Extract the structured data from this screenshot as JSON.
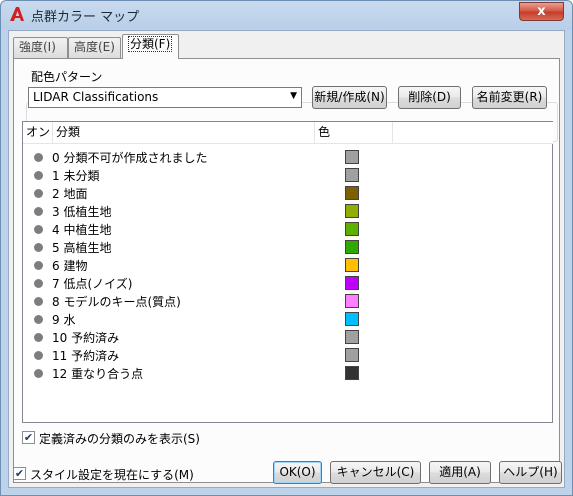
{
  "window": {
    "title": "点群カラー マップ",
    "close_glyph": "x",
    "app_icon_letter": "A"
  },
  "tabs": [
    {
      "label": "強度(I)"
    },
    {
      "label": "高度(E)"
    },
    {
      "label": "分類(F)"
    }
  ],
  "pattern": {
    "group_label": "配色パターン",
    "selected": "LIDAR Classifications",
    "new_button": "新規/作成(N)",
    "delete_button": "削除(D)",
    "rename_button": "名前変更(R)"
  },
  "list": {
    "columns": {
      "on": "オン",
      "class": "分類",
      "color": "色"
    },
    "rows": [
      {
        "label": "0 分類不可が作成されました",
        "color": "#a0a0a0"
      },
      {
        "label": "1 未分類",
        "color": "#a0a0a0"
      },
      {
        "label": "2 地面",
        "color": "#7f5f00"
      },
      {
        "label": "3 低植生地",
        "color": "#8faf00"
      },
      {
        "label": "4 中植生地",
        "color": "#5faf00"
      },
      {
        "label": "5 高植生地",
        "color": "#2fa800"
      },
      {
        "label": "6 建物",
        "color": "#ffbf00"
      },
      {
        "label": "7 低点(ノイズ)",
        "color": "#bf00ff"
      },
      {
        "label": "8 モデルのキー点(質点)",
        "color": "#ff80ff"
      },
      {
        "label": "9 水",
        "color": "#00bfff"
      },
      {
        "label": "10 予約済み",
        "color": "#a0a0a0"
      },
      {
        "label": "11 予約済み",
        "color": "#a0a0a0"
      },
      {
        "label": "12 重なり合う点",
        "color": "#333333"
      }
    ]
  },
  "show_defined_only": {
    "label": "定義済みの分類のみを表示(S)",
    "checked": true
  },
  "set_current_style": {
    "label": "スタイル設定を現在にする(M)",
    "checked": true
  },
  "buttons": {
    "ok": "OK(O)",
    "cancel": "キャンセル(C)",
    "apply": "適用(A)",
    "help": "ヘルプ(H)"
  }
}
